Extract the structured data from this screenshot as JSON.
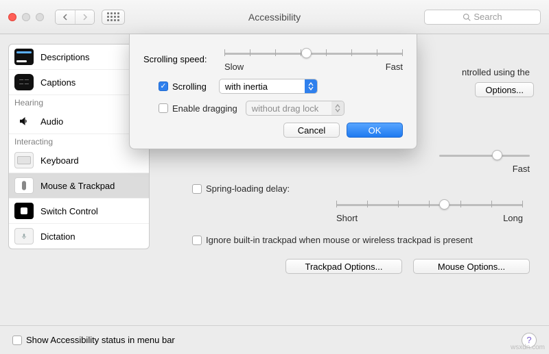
{
  "window": {
    "title": "Accessibility"
  },
  "search": {
    "placeholder": "Search"
  },
  "sidebar": {
    "groups": [
      {
        "label": "",
        "items": [
          {
            "label": "Descriptions"
          },
          {
            "label": "Captions"
          }
        ]
      },
      {
        "label": "Hearing",
        "items": [
          {
            "label": "Audio"
          }
        ]
      },
      {
        "label": "Interacting",
        "items": [
          {
            "label": "Keyboard"
          },
          {
            "label": "Mouse & Trackpad"
          },
          {
            "label": "Switch Control"
          },
          {
            "label": "Dictation"
          }
        ]
      }
    ]
  },
  "pane": {
    "intro_fragment": "ntrolled using the",
    "options_button": "Options...",
    "dc_slider": {
      "fast": "Fast"
    },
    "spring": {
      "label": "Spring-loading delay:",
      "short": "Short",
      "long": "Long"
    },
    "ignore_trackpad": "Ignore built-in trackpad when mouse or wireless trackpad is present",
    "trackpad_options_btn": "Trackpad Options...",
    "mouse_options_btn": "Mouse Options..."
  },
  "sheet": {
    "speed_label": "Scrolling speed:",
    "slow": "Slow",
    "fast": "Fast",
    "scrolling_label": "Scrolling",
    "scrolling_value": "with inertia",
    "dragging_label": "Enable dragging",
    "dragging_value": "without drag lock",
    "cancel": "Cancel",
    "ok": "OK"
  },
  "footer": {
    "status_label": "Show Accessibility status in menu bar"
  },
  "watermark": "wsxdn.com"
}
